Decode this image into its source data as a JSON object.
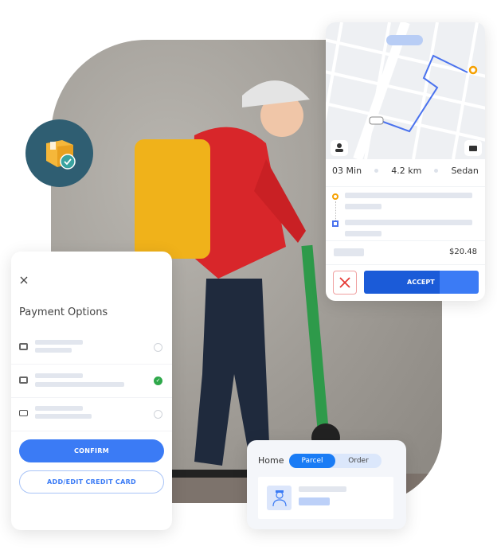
{
  "ride": {
    "time": "03 Min",
    "distance": "4.2 km",
    "vehicle": "Sedan",
    "price": "$20.48",
    "accept_label": "ACCEPT"
  },
  "payment": {
    "title": "Payment Options",
    "confirm_label": "CONFIRM",
    "add_card_label": "ADD/EDIT CREDIT CARD",
    "selected_index": 1
  },
  "home": {
    "title": "Home",
    "tabs": [
      "Parcel",
      "Order"
    ],
    "active_tab": "Parcel"
  },
  "colors": {
    "accent": "#3b7bf5",
    "accept": "#1b5bd8",
    "success": "#2ea84a",
    "badge": "#2f5e72",
    "pickup": "#f5a000"
  }
}
